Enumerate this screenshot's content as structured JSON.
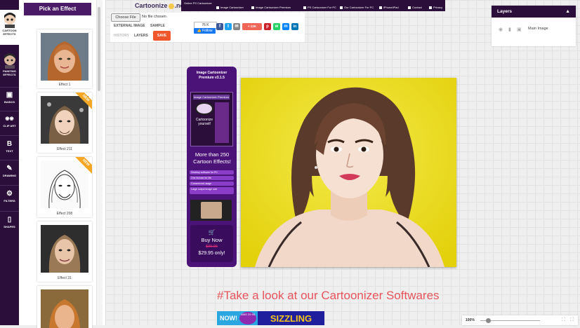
{
  "app": {
    "logo": "Cartoonize",
    "logo_suffix": ".net"
  },
  "nav": {
    "top_label": "Online PS Cartoonizer",
    "items": [
      "Image Cartoonizer",
      "Image Cartoonizer Premium",
      "PS Cartoonizer For PC",
      "Our Cartoonizer For PC",
      "iPhone/iPad",
      "Contact",
      "Privacy"
    ]
  },
  "toolbar": {
    "tools": [
      {
        "label": "CARTOON EFFECTS",
        "icon": "face-avatar-icon"
      },
      {
        "label": "PAINTING EFFECTS",
        "icon": "painting-face-icon"
      },
      {
        "label": "BASICS",
        "icon": "image-icon"
      },
      {
        "label": "CLIP ART",
        "icon": "eyes-icon"
      },
      {
        "label": "TEXT",
        "icon": "text-b-icon"
      },
      {
        "label": "DRAWING",
        "icon": "brush-icon"
      },
      {
        "label": "FILTERS",
        "icon": "gear-icon"
      },
      {
        "label": "SHAPES",
        "icon": "shapes-icon"
      }
    ],
    "glyphs": {
      "image": "▣",
      "eyes": "◉◉",
      "text": "B",
      "brush": "✎",
      "gear": "⚙",
      "shapes": "▯"
    }
  },
  "effects": {
    "header": "Pick an Effect",
    "items": [
      {
        "label": "Effect 1",
        "new": false,
        "style": "color"
      },
      {
        "label": "Effect 211",
        "new": true,
        "style": "color"
      },
      {
        "label": "Effect 208",
        "new": true,
        "style": "sketch"
      },
      {
        "label": "Effect 31",
        "new": false,
        "style": "color"
      },
      {
        "label": "",
        "new": false,
        "style": "color"
      }
    ],
    "new_label": "NEW"
  },
  "file_input": {
    "button": "Choose File",
    "status": "No file chosen"
  },
  "controls": {
    "external_image": "EXTERNAL IMAGE",
    "sample": "SAMPLE",
    "history": "HISTORY",
    "layers": "LAYERS",
    "save": "SAVE"
  },
  "social": {
    "like_count": "76 K",
    "like_label": "👍 Follow",
    "buttons": [
      {
        "icon": "f",
        "color": "#3b5998"
      },
      {
        "icon": "t",
        "color": "#1da1f2"
      },
      {
        "icon": "✉",
        "color": "#888888"
      },
      {
        "icon": "+ 13K",
        "color": "#f2665a"
      },
      {
        "icon": "p",
        "color": "#cb2027"
      },
      {
        "icon": "w",
        "color": "#25d366"
      },
      {
        "icon": "m",
        "color": "#0084ff"
      },
      {
        "icon": "in",
        "color": "#0077b5"
      }
    ]
  },
  "promo": {
    "title": "Image Cartoonizer Premium v3.1.5",
    "box_label": "Image Cartoonizer Premium",
    "box_text": "Cartoonize yourself",
    "headline": "More than 250 Cartoon Effects!",
    "features": [
      "Desktop software for PC",
      "One license for life",
      "Commercial usage",
      "Large output image size"
    ],
    "buy_label": "Buy Now",
    "old_price": "$39.95",
    "new_price": "$29.95 only!"
  },
  "bottom": {
    "headline": "#Take a look at our Cartoonizer Softwares",
    "promo1_text": "NOW!",
    "badge_text": "WAS 29.95",
    "promo2_text": "SIZZLING"
  },
  "layers": {
    "title": "Layers",
    "items": [
      {
        "name": "Main Image"
      }
    ]
  },
  "zoom": {
    "level": "100%",
    "fraction": 0.1
  },
  "colors": {
    "brand": "#2b0e3a",
    "accent": "#f0572c",
    "promo": "#4b1377",
    "canvas_bg": "#eadb12"
  }
}
